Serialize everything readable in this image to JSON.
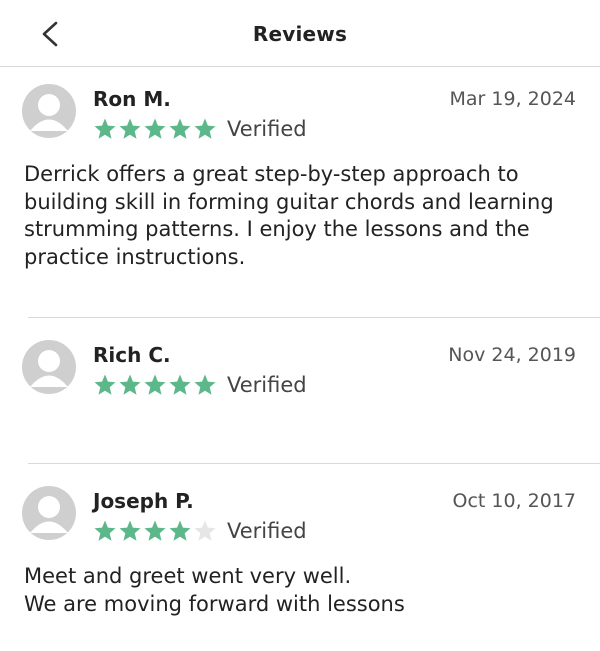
{
  "header": {
    "title": "Reviews",
    "back_icon": "chevron-left-icon"
  },
  "colors": {
    "star_filled": "#5cb88a",
    "star_empty": "#e6e6e6",
    "avatar": "#cfcfcf",
    "divider": "#d9d9d9"
  },
  "reviews": [
    {
      "name": "Ron M.",
      "date": "Mar 19, 2024",
      "rating": 5,
      "verified": "Verified",
      "text": "Derrick offers a great step-by-step approach to\nbuilding skill in forming guitar chords and learning\nstrumming patterns. I enjoy the lessons and the\npractice instructions."
    },
    {
      "name": "Rich C.",
      "date": "Nov 24, 2019",
      "rating": 5,
      "verified": "Verified",
      "text": ""
    },
    {
      "name": "Joseph P.",
      "date": "Oct 10, 2017",
      "rating": 4,
      "verified": "Verified",
      "text": "Meet and greet went very well.\nWe are moving forward with lessons"
    }
  ]
}
